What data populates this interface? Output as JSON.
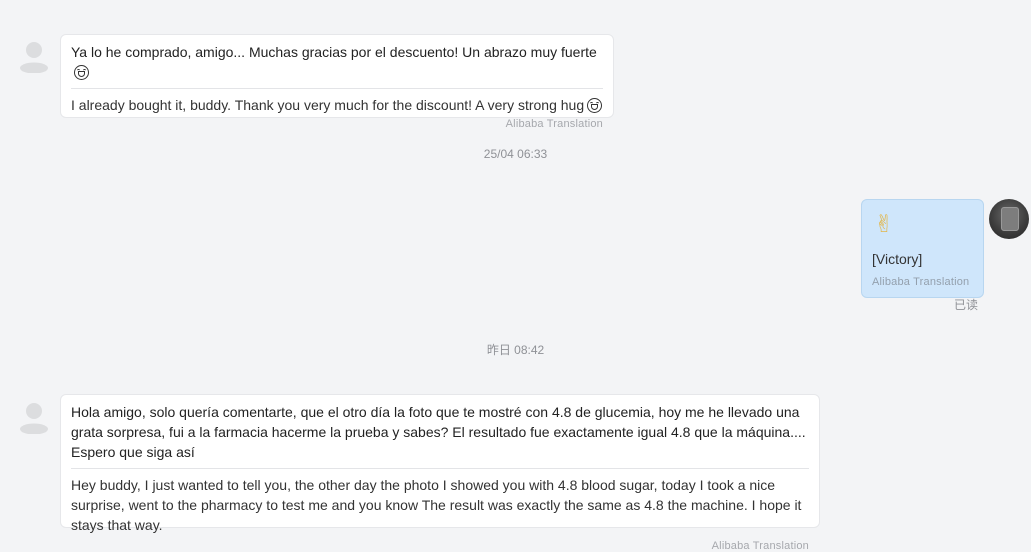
{
  "messages": {
    "first": {
      "original": "Ya lo he comprado, amigo... Muchas gracias por el descuento! Un abrazo muy fuerte",
      "translation": "I already bought it, buddy. Thank you very much for the discount! A very strong hug",
      "source": "Alibaba Translation"
    },
    "timestamp1": "25/04 06:33",
    "mine": {
      "emoji": "✌",
      "text": "[Victory]",
      "source": "Alibaba Translation",
      "status": "已读"
    },
    "timestamp2": "昨日 08:42",
    "second": {
      "original": "Hola amigo, solo quería comentarte, que el otro día la foto que te mostré con 4.8 de glucemia, hoy me he llevado una grata sorpresa, fui a la farmacia hacerme la prueba y sabes? El resultado fue exactamente igual 4.8 que la máquina.... Espero que siga así",
      "translation": "Hey buddy, I just wanted to tell you, the other day the photo I showed you with 4.8 blood sugar, today I took a nice surprise, went to the pharmacy to test me and you know The result was exactly the same as 4.8 the machine. I hope it stays that way.",
      "source": "Alibaba Translation"
    }
  },
  "icons": {
    "contact_avatar": "default-user-avatar-icon",
    "emoji_hug": "hug-face-emoji-icon",
    "my_avatar": "user-photo-avatar"
  }
}
